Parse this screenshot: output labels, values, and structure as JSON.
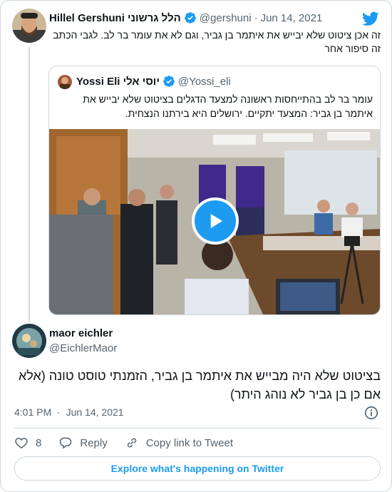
{
  "tweet_top": {
    "author_name": "Hillel Gershuni הלל גרשוני",
    "handle": "@gershuni",
    "separator": "·",
    "date": "Jun 14, 2021",
    "text": "זה אכן ציטוט שלא יבייש את איתמר בן גביר, וגם לא את עומר בר לב. לגבי הכתב זה סיפור אחר"
  },
  "quoted": {
    "author_name": "Yossi Eli יוסי אלי",
    "handle": "@Yossi_eli",
    "text": "עומר בר לב בהתייחסות ראשונה למצעד הדגלים בציטוט שלא יבייש את איתמר בן גביר: המצעד יתקיים. ירושלים היא בירתנו הנצחית."
  },
  "tweet_main": {
    "author_name": "maor eichler",
    "handle": "@EichlerMaor",
    "text": "בציטוט שלא היה מבייש את איתמר בן גביר, הזמנתי טוסט טונה (אלא אם כן בן גביר לא נוהג היתר)",
    "time": "4:01 PM",
    "separator": "·",
    "date": "Jun 14, 2021"
  },
  "actions": {
    "like_count": "8",
    "reply_label": "Reply",
    "copy_label": "Copy link to Tweet"
  },
  "explore_label": "Explore what's happening on Twitter",
  "colors": {
    "brand": "#1d9bf0",
    "text": "#0f1419",
    "muted": "#536471",
    "border": "#cfd9de"
  },
  "icons": [
    "twitter-bird-icon",
    "verified-badge-icon",
    "play-icon",
    "info-icon",
    "heart-icon",
    "reply-icon",
    "link-icon"
  ]
}
